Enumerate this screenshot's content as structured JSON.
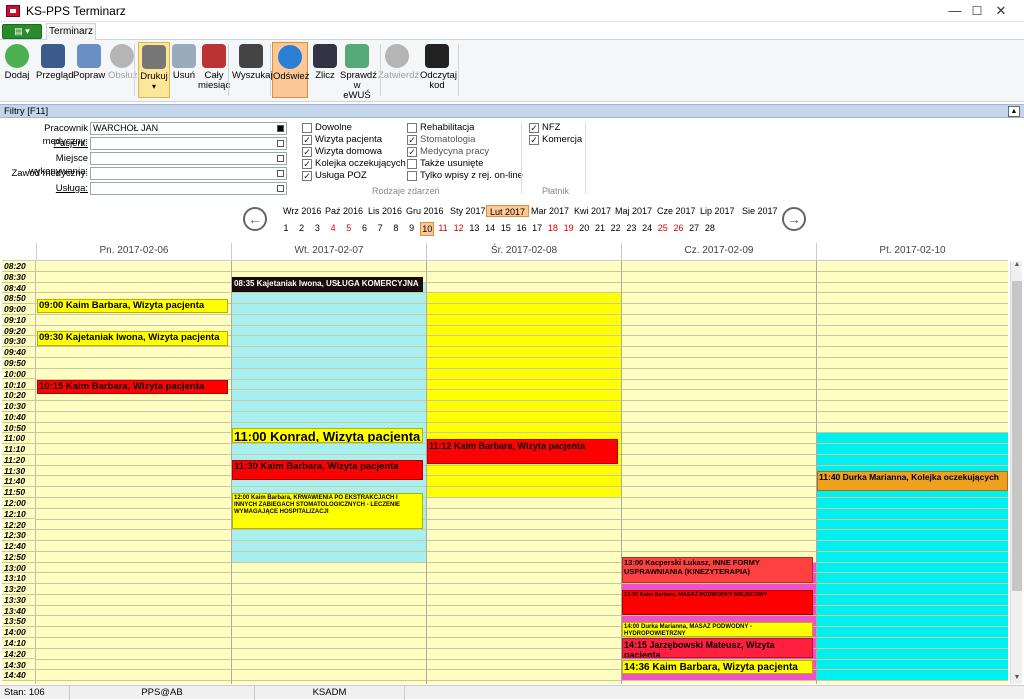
{
  "window": {
    "title": "KS-PPS Terminarz",
    "minimize": "—",
    "maximize": "☐",
    "close": "✕"
  },
  "ribbon": {
    "file_label": "▤ ▾",
    "tab": "Terminarz",
    "buttons": [
      {
        "label": "Dodaj",
        "icon": "add-icon",
        "color": "#4caf50"
      },
      {
        "label": "Przegląd",
        "icon": "eye-icon",
        "color": "#3b5b8c"
      },
      {
        "label": "Popraw",
        "icon": "edit-pen-icon",
        "color": "#6b8fc4"
      },
      {
        "label": "Obsłuż",
        "icon": "check-icon",
        "color": "#b5b5b5"
      },
      {
        "label": "Drukuj",
        "icon": "printer-icon",
        "color": "#777"
      },
      {
        "label": "Usuń",
        "icon": "trash-icon",
        "color": "#9ab"
      },
      {
        "label": "Cały miesiąc",
        "icon": "calendar-icon",
        "color": "#b33"
      },
      {
        "label": "Wyszukaj",
        "icon": "binoculars-icon",
        "color": "#444"
      },
      {
        "label": "Odśwież",
        "icon": "refresh-icon",
        "color": "#2a7fd4"
      },
      {
        "label": "Zlicz",
        "icon": "calculator-icon",
        "color": "#334"
      },
      {
        "label": "Sprawdź w eWUŚ",
        "icon": "user-check-icon",
        "color": "#5a7"
      },
      {
        "label": "Zatwierdź",
        "icon": "approve-icon",
        "color": "#b5b5b5"
      },
      {
        "label": "Odczytaj kod",
        "icon": "qr-code-icon",
        "color": "#222"
      }
    ],
    "print_caret": "▾"
  },
  "filters": {
    "header": "Filtry [F11]",
    "collapse": "▲",
    "fields": [
      {
        "label": "Pracownik medyczny:",
        "value": "WARCHOŁ JAN"
      },
      {
        "label": "Pacjent:",
        "value": ""
      },
      {
        "label": "Miejsce wykonywania:",
        "value": ""
      },
      {
        "label": "Zawód medyczny:",
        "value": ""
      },
      {
        "label": "Usługa:",
        "value": ""
      }
    ],
    "event_types": [
      {
        "label": "Dowolne",
        "checked": false
      },
      {
        "label": "Wizyta pacjenta",
        "checked": true
      },
      {
        "label": "Wizyta domowa",
        "checked": true
      },
      {
        "label": "Kolejka oczekujących",
        "checked": true
      },
      {
        "label": "Usługa POZ",
        "checked": true
      },
      {
        "label": "Rehabilitacja",
        "checked": false
      },
      {
        "label": "Stomatologia",
        "checked": true
      },
      {
        "label": "Medycyna pracy",
        "checked": true
      },
      {
        "label": "Także usunięte",
        "checked": false
      },
      {
        "label": "Tylko wpisy z rej. on-line",
        "checked": false
      }
    ],
    "event_types_caption": "Rodzaje zdarzeń",
    "payers": [
      {
        "label": "NFZ",
        "checked": true
      },
      {
        "label": "Komercja",
        "checked": true
      }
    ],
    "payers_caption": "Płatnik",
    "check_mark": "✓"
  },
  "nav": {
    "prev": "←",
    "next": "→",
    "months": [
      "Wrz 2016",
      "Paź 2016",
      "Lis 2016",
      "Gru 2016",
      "Sty 2017",
      "Lut 2017",
      "Mar 2017",
      "Kwi 2017",
      "Maj 2017",
      "Cze 2017",
      "Lip 2017",
      "Sie 2017"
    ],
    "selected_month": "Lut 2017",
    "days": [
      "1",
      "2",
      "3",
      "4",
      "5",
      "6",
      "7",
      "8",
      "9",
      "10",
      "11",
      "12",
      "13",
      "14",
      "15",
      "16",
      "17",
      "18",
      "19",
      "20",
      "21",
      "22",
      "23",
      "24",
      "25",
      "26",
      "27",
      "28"
    ],
    "weekend_days": [
      "4",
      "5",
      "11",
      "12",
      "18",
      "19",
      "25",
      "26"
    ],
    "selected_day": "10"
  },
  "calendar": {
    "days": [
      "Pn. 2017-02-06",
      "Wt. 2017-02-07",
      "Śr. 2017-02-08",
      "Cz. 2017-02-09",
      "Pt. 2017-02-10"
    ],
    "times": [
      "08:20",
      "08:30",
      "08:40",
      "08:50",
      "09:00",
      "09:10",
      "09:20",
      "09:30",
      "09:40",
      "09:50",
      "10:00",
      "10:10",
      "10:20",
      "10:30",
      "10:40",
      "10:50",
      "11:00",
      "11:10",
      "11:20",
      "11:30",
      "11:40",
      "11:50",
      "12:00",
      "12:10",
      "12:20",
      "12:30",
      "12:40",
      "12:50",
      "13:00",
      "13:10",
      "13:20",
      "13:30",
      "13:40",
      "13:50",
      "14:00",
      "14:10",
      "14:20",
      "14:30",
      "14:40"
    ],
    "availability": [
      {
        "day": 1,
        "from": "08:40",
        "to": "12:50",
        "color": "#a8f0f0"
      },
      {
        "day": 2,
        "from": "08:50",
        "to": "11:50",
        "color": "#ffff00"
      },
      {
        "day": 4,
        "from": "11:00",
        "to": "14:40",
        "color": "#00f0f0"
      },
      {
        "day": 3,
        "from": "13:00",
        "to": "14:40",
        "color": "#f050c8"
      }
    ],
    "events": [
      {
        "day": 1,
        "start": "08:35",
        "end": "08:45",
        "text": "08:35 Kajetaniak Iwona, USŁUGA KOMERCYJNA",
        "bg": "#1a0a0a",
        "fg": "#ffffff",
        "size": "8"
      },
      {
        "day": 0,
        "start": "08:55",
        "end": "09:05",
        "text": "09:00 Kaim Barbara, Wizyta pacjenta",
        "bg": "#ffff00",
        "fg": "#000000",
        "size": "9.5"
      },
      {
        "day": 0,
        "start": "09:25",
        "end": "09:35",
        "text": "09:30 Kajetaniak Iwona, Wizyta pacjenta",
        "bg": "#ffff00",
        "fg": "#000000",
        "size": "9.5"
      },
      {
        "day": 0,
        "start": "10:10",
        "end": "10:20",
        "text": "10:15 Kaim Barbara, Wizyta pacjenta",
        "bg": "#ff0000",
        "fg": "#000000",
        "size": "9.5"
      },
      {
        "day": 1,
        "start": "10:55",
        "end": "11:05",
        "text": "11:00 Konrad, Wizyta pacjenta",
        "bg": "#ffff00",
        "fg": "#000000",
        "size": "13"
      },
      {
        "day": 2,
        "start": "11:05",
        "end": "11:25",
        "text": "11:12 Kaim Barbara, Wizyta pacjenta",
        "bg": "#ff0000",
        "fg": "#000000",
        "size": "9"
      },
      {
        "day": 1,
        "start": "11:25",
        "end": "11:40",
        "text": "11:30 Kaim Barbara, Wizyta pacjenta",
        "bg": "#ff0000",
        "fg": "#000000",
        "size": "9.5"
      },
      {
        "day": 4,
        "start": "11:35",
        "end": "11:50",
        "text": "11:40 Durka Marianna, Kolejka oczekujących",
        "bg": "#f0a020",
        "fg": "#000000",
        "size": "8.5"
      },
      {
        "day": 1,
        "start": "11:55",
        "end": "12:25",
        "text": "12:00 Kaim Barbara, KRWAWIENIA PO EKSTRAKCJACH I INNYCH ZABIEGACH STOMATOLOGICZNYCH - LECZENIE WYMAGAJĄCE HOSPITALIZACJI",
        "bg": "#ffff00",
        "fg": "#000000",
        "size": "6"
      },
      {
        "day": 3,
        "start": "12:55",
        "end": "13:15",
        "text": "13:00 Kacperski Łukasz, INNE FORMY USPRAWNIANIA (KINEZYTERAPIA)",
        "bg": "#ff4040",
        "fg": "#000000",
        "size": "7.5"
      },
      {
        "day": 3,
        "start": "13:25",
        "end": "13:45",
        "text": "13:30 Kaim Barbara, MASAŻ PODWODNY MIEJSCOWY",
        "bg": "#ff0000",
        "fg": "#000000",
        "size": "5.5"
      },
      {
        "day": 3,
        "start": "13:55",
        "end": "14:05",
        "text": "14:00 Durka Marianna, MASAŻ PODWODNY - HYDROPOWIETRZNY",
        "bg": "#ffff00",
        "fg": "#000000",
        "size": "6"
      },
      {
        "day": 3,
        "start": "14:10",
        "end": "14:25",
        "text": "14:15 Jarzębowski Mateusz, Wizyta pacjenta",
        "bg": "#ff2040",
        "fg": "#000000",
        "size": "9"
      },
      {
        "day": 3,
        "start": "14:30",
        "end": "14:40",
        "text": "14:36 Kaim Barbara, Wizyta pacjenta",
        "bg": "#ffff00",
        "fg": "#000000",
        "size": "10"
      }
    ]
  },
  "status": {
    "count": "Stan: 106",
    "user": "PPS@AB",
    "db": "KSADM"
  }
}
